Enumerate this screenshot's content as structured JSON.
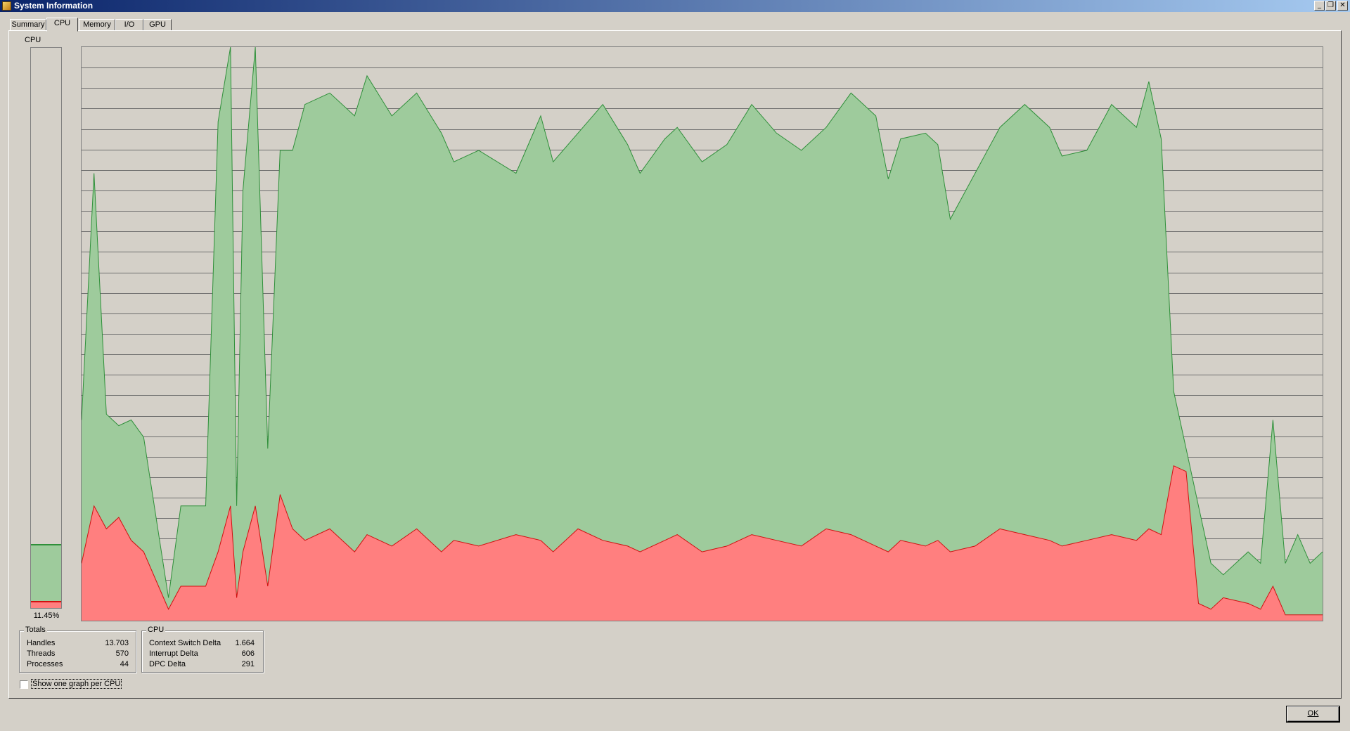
{
  "window": {
    "title": "System Information",
    "minimize_icon": "minimize-icon",
    "restore_icon": "restore-icon",
    "close_icon": "close-icon"
  },
  "tabs": [
    {
      "label": "Summary",
      "active": false
    },
    {
      "label": "CPU",
      "active": true
    },
    {
      "label": "Memory",
      "active": false
    },
    {
      "label": "I/O",
      "active": false
    },
    {
      "label": "GPU",
      "active": false
    }
  ],
  "cpu_meter": {
    "label": "CPU",
    "value_text": "11.45%",
    "total_fraction": 0.114,
    "kernel_fraction": 0.013
  },
  "totals": {
    "title": "Totals",
    "rows": [
      {
        "label": "Handles",
        "value": "13.703"
      },
      {
        "label": "Threads",
        "value": "570"
      },
      {
        "label": "Processes",
        "value": "44"
      }
    ]
  },
  "cpu_stats": {
    "title": "CPU",
    "rows": [
      {
        "label": "Context Switch Delta",
        "value": "1.664"
      },
      {
        "label": "Interrupt Delta",
        "value": "606"
      },
      {
        "label": "DPC Delta",
        "value": "291"
      }
    ]
  },
  "option": {
    "label": "Show one graph per CPU",
    "checked": false
  },
  "ok_button": {
    "label": "OK"
  },
  "colors": {
    "total_fill": "#9ecb9c",
    "total_line": "#2f8f3a",
    "kernel_fill": "#ff7f7f",
    "kernel_line": "#d01010",
    "grid": "#6e6e6e"
  },
  "chart_data": {
    "type": "area",
    "ylim": [
      0,
      100
    ],
    "grid": true,
    "series": [],
    "points_total": [
      [
        0,
        35
      ],
      [
        1,
        78
      ],
      [
        2,
        36
      ],
      [
        3,
        34
      ],
      [
        4,
        35
      ],
      [
        5,
        32
      ],
      [
        7,
        4
      ],
      [
        8,
        20
      ],
      [
        10,
        20
      ],
      [
        11,
        87
      ],
      [
        12,
        100
      ],
      [
        12.5,
        20
      ],
      [
        13,
        75
      ],
      [
        14,
        100
      ],
      [
        15,
        30
      ],
      [
        16,
        82
      ],
      [
        17,
        82
      ],
      [
        18,
        90
      ],
      [
        20,
        92
      ],
      [
        22,
        88
      ],
      [
        23,
        95
      ],
      [
        25,
        88
      ],
      [
        27,
        92
      ],
      [
        29,
        85
      ],
      [
        30,
        80
      ],
      [
        32,
        82
      ],
      [
        35,
        78
      ],
      [
        37,
        88
      ],
      [
        38,
        80
      ],
      [
        40,
        85
      ],
      [
        42,
        90
      ],
      [
        44,
        83
      ],
      [
        45,
        78
      ],
      [
        47,
        84
      ],
      [
        48,
        86
      ],
      [
        50,
        80
      ],
      [
        52,
        83
      ],
      [
        54,
        90
      ],
      [
        56,
        85
      ],
      [
        58,
        82
      ],
      [
        60,
        86
      ],
      [
        62,
        92
      ],
      [
        64,
        88
      ],
      [
        65,
        77
      ],
      [
        66,
        84
      ],
      [
        68,
        85
      ],
      [
        69,
        83
      ],
      [
        70,
        70
      ],
      [
        72,
        78
      ],
      [
        74,
        86
      ],
      [
        76,
        90
      ],
      [
        78,
        86
      ],
      [
        79,
        81
      ],
      [
        81,
        82
      ],
      [
        83,
        90
      ],
      [
        85,
        86
      ],
      [
        86,
        94
      ],
      [
        87,
        84
      ],
      [
        88,
        40
      ],
      [
        89,
        30
      ],
      [
        90,
        20
      ],
      [
        91,
        10
      ],
      [
        92,
        8
      ],
      [
        94,
        12
      ],
      [
        95,
        10
      ],
      [
        96,
        35
      ],
      [
        97,
        10
      ],
      [
        98,
        15
      ],
      [
        99,
        10
      ],
      [
        100,
        12
      ]
    ],
    "points_kernel": [
      [
        0,
        10
      ],
      [
        1,
        20
      ],
      [
        2,
        16
      ],
      [
        3,
        18
      ],
      [
        4,
        14
      ],
      [
        5,
        12
      ],
      [
        7,
        2
      ],
      [
        8,
        6
      ],
      [
        10,
        6
      ],
      [
        11,
        12
      ],
      [
        12,
        20
      ],
      [
        12.5,
        4
      ],
      [
        13,
        12
      ],
      [
        14,
        20
      ],
      [
        15,
        6
      ],
      [
        16,
        22
      ],
      [
        17,
        16
      ],
      [
        18,
        14
      ],
      [
        20,
        16
      ],
      [
        22,
        12
      ],
      [
        23,
        15
      ],
      [
        25,
        13
      ],
      [
        27,
        16
      ],
      [
        29,
        12
      ],
      [
        30,
        14
      ],
      [
        32,
        13
      ],
      [
        35,
        15
      ],
      [
        37,
        14
      ],
      [
        38,
        12
      ],
      [
        40,
        16
      ],
      [
        42,
        14
      ],
      [
        44,
        13
      ],
      [
        45,
        12
      ],
      [
        47,
        14
      ],
      [
        48,
        15
      ],
      [
        50,
        12
      ],
      [
        52,
        13
      ],
      [
        54,
        15
      ],
      [
        56,
        14
      ],
      [
        58,
        13
      ],
      [
        60,
        16
      ],
      [
        62,
        15
      ],
      [
        64,
        13
      ],
      [
        65,
        12
      ],
      [
        66,
        14
      ],
      [
        68,
        13
      ],
      [
        69,
        14
      ],
      [
        70,
        12
      ],
      [
        72,
        13
      ],
      [
        74,
        16
      ],
      [
        76,
        15
      ],
      [
        78,
        14
      ],
      [
        79,
        13
      ],
      [
        81,
        14
      ],
      [
        83,
        15
      ],
      [
        85,
        14
      ],
      [
        86,
        16
      ],
      [
        87,
        15
      ],
      [
        88,
        27
      ],
      [
        89,
        26
      ],
      [
        90,
        3
      ],
      [
        91,
        2
      ],
      [
        92,
        4
      ],
      [
        94,
        3
      ],
      [
        95,
        2
      ],
      [
        96,
        6
      ],
      [
        97,
        1
      ],
      [
        98,
        1
      ],
      [
        99,
        1
      ],
      [
        100,
        1
      ]
    ]
  }
}
